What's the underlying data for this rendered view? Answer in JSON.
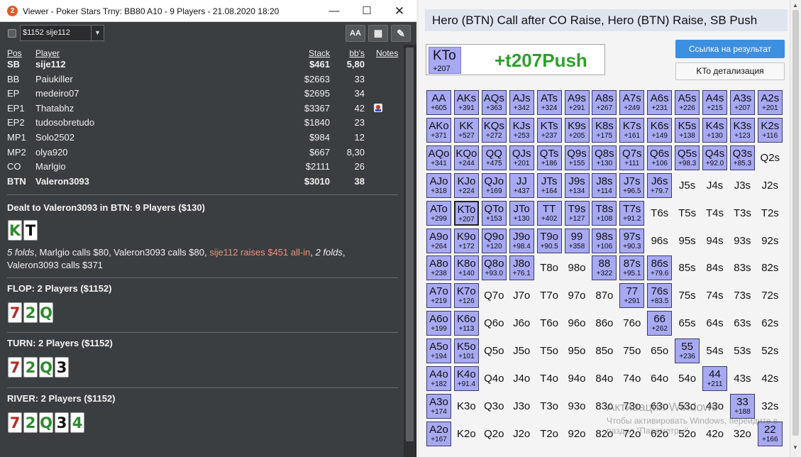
{
  "window": {
    "badge": "2",
    "title": "Viewer - Poker Stars Trny: BB80 A10 - 9 Players - 21.08.2020 18:20"
  },
  "toolbar": {
    "select_value": "$1152 sije112",
    "aa_label": "AA"
  },
  "players_table": {
    "headers": {
      "pos": "Pos",
      "player": "Player",
      "stack": "Stack",
      "bbs": "bb's",
      "notes": "Notes"
    },
    "rows": [
      {
        "pos": "SB",
        "name": "sije112",
        "stack": "$461",
        "bb": "5,80",
        "bold": true
      },
      {
        "pos": "BB",
        "name": "Paiukiller",
        "stack": "$2663",
        "bb": "33",
        "bold": false
      },
      {
        "pos": "EP",
        "name": "medeiro07",
        "stack": "$2695",
        "bb": "34",
        "bold": false
      },
      {
        "pos": "EP1",
        "name": "Thatabhz",
        "stack": "$3367",
        "bb": "42",
        "bold": false,
        "note": true
      },
      {
        "pos": "EP2",
        "name": "tudosobretudo",
        "stack": "$1840",
        "bb": "23",
        "bold": false
      },
      {
        "pos": "MP1",
        "name": "Solo2502",
        "stack": "$984",
        "bb": "12",
        "bold": false
      },
      {
        "pos": "MP2",
        "name": "olya920",
        "stack": "$667",
        "bb": "8,30",
        "bold": false
      },
      {
        "pos": "CO",
        "name": "Marlgio",
        "stack": "$2111",
        "bb": "26",
        "bold": false
      },
      {
        "pos": "BTN",
        "name": "Valeron3093",
        "stack": "$3010",
        "bb": "38",
        "bold": true
      }
    ]
  },
  "dealt": {
    "title": "Dealt to Valeron3093 in BTN: 9 Players ($130)",
    "cards": [
      {
        "rank": "K",
        "suit": "c"
      },
      {
        "rank": "T",
        "suit": "s"
      }
    ],
    "action_segments": [
      {
        "text": "5 folds",
        "style": "it"
      },
      {
        "text": ", Marlgio calls $80, Valeron3093 calls $80, ",
        "style": ""
      },
      {
        "text": "sije112 raises $451 all-in",
        "style": "raise"
      },
      {
        "text": ", ",
        "style": ""
      },
      {
        "text": "2 folds",
        "style": "it"
      },
      {
        "text": ",",
        "style": ""
      },
      {
        "text": " Valeron3093 calls $371",
        "style": ""
      }
    ]
  },
  "streets": [
    {
      "title": "FLOP: 2 Players ($1152)",
      "cards": [
        {
          "rank": "7",
          "suit": "h"
        },
        {
          "rank": "2",
          "suit": "c"
        },
        {
          "rank": "Q",
          "suit": "c"
        }
      ]
    },
    {
      "title": "TURN: 2 Players ($1152)",
      "cards": [
        {
          "rank": "7",
          "suit": "h"
        },
        {
          "rank": "2",
          "suit": "c"
        },
        {
          "rank": "Q",
          "suit": "c"
        },
        {
          "rank": "3",
          "suit": "s"
        }
      ]
    },
    {
      "title": "RIVER: 2 Players ($1152)",
      "cards": [
        {
          "rank": "7",
          "suit": "h"
        },
        {
          "rank": "2",
          "suit": "c"
        },
        {
          "rank": "Q",
          "suit": "c"
        },
        {
          "rank": "3",
          "suit": "s"
        },
        {
          "rank": "4",
          "suit": "c"
        }
      ]
    }
  ],
  "right_panel": {
    "header": "Hero (BTN) Call after CO Raise, Hero (BTN) Raise, SB Push",
    "hand": "KTo",
    "hand_ev": "+207",
    "result": "+t207Push",
    "link_button": "Ссылка на результат",
    "detail_button": "KTo детализация"
  },
  "range_grid": [
    [
      [
        "AA",
        "+605"
      ],
      [
        "AKs",
        "+391"
      ],
      [
        "AQs",
        "+363"
      ],
      [
        "AJs",
        "+342"
      ],
      [
        "ATs",
        "+324"
      ],
      [
        "A9s",
        "+291"
      ],
      [
        "A8s",
        "+267"
      ],
      [
        "A7s",
        "+249"
      ],
      [
        "A6s",
        "+231"
      ],
      [
        "A5s",
        "+226"
      ],
      [
        "A4s",
        "+215"
      ],
      [
        "A3s",
        "+207"
      ],
      [
        "A2s",
        "+201"
      ]
    ],
    [
      [
        "AKo",
        "+371"
      ],
      [
        "KK",
        "+527"
      ],
      [
        "KQs",
        "+272"
      ],
      [
        "KJs",
        "+253"
      ],
      [
        "KTs",
        "+237"
      ],
      [
        "K9s",
        "+205"
      ],
      [
        "K8s",
        "+175"
      ],
      [
        "K7s",
        "+161"
      ],
      [
        "K6s",
        "+149"
      ],
      [
        "K5s",
        "+138"
      ],
      [
        "K4s",
        "+130"
      ],
      [
        "K3s",
        "+123"
      ],
      [
        "K2s",
        "+116"
      ]
    ],
    [
      [
        "AQo",
        "+341"
      ],
      [
        "KQo",
        "+244"
      ],
      [
        "QQ",
        "+475"
      ],
      [
        "QJs",
        "+201"
      ],
      [
        "QTs",
        "+186"
      ],
      [
        "Q9s",
        "+155"
      ],
      [
        "Q8s",
        "+130"
      ],
      [
        "Q7s",
        "+111"
      ],
      [
        "Q6s",
        "+106"
      ],
      [
        "Q5s",
        "+98.3"
      ],
      [
        "Q4s",
        "+92.0"
      ],
      [
        "Q3s",
        "+85.3"
      ],
      [
        "Q2s",
        ""
      ]
    ],
    [
      [
        "AJo",
        "+318"
      ],
      [
        "KJo",
        "+224"
      ],
      [
        "QJo",
        "+169"
      ],
      [
        "JJ",
        "+437"
      ],
      [
        "JTs",
        "+164"
      ],
      [
        "J9s",
        "+134"
      ],
      [
        "J8s",
        "+114"
      ],
      [
        "J7s",
        "+96.5"
      ],
      [
        "J6s",
        "+79.7"
      ],
      [
        "J5s",
        ""
      ],
      [
        "J4s",
        ""
      ],
      [
        "J3s",
        ""
      ],
      [
        "J2s",
        ""
      ]
    ],
    [
      [
        "ATo",
        "+299"
      ],
      [
        "KTo",
        "+207"
      ],
      [
        "QTo",
        "+153"
      ],
      [
        "JTo",
        "+130"
      ],
      [
        "TT",
        "+402"
      ],
      [
        "T9s",
        "+127"
      ],
      [
        "T8s",
        "+108"
      ],
      [
        "T7s",
        "+91.2"
      ],
      [
        "T6s",
        ""
      ],
      [
        "T5s",
        ""
      ],
      [
        "T4s",
        ""
      ],
      [
        "T3s",
        ""
      ],
      [
        "T2s",
        ""
      ]
    ],
    [
      [
        "A9o",
        "+264"
      ],
      [
        "K9o",
        "+172"
      ],
      [
        "Q9o",
        "+120"
      ],
      [
        "J9o",
        "+98.4"
      ],
      [
        "T9o",
        "+90.5"
      ],
      [
        "99",
        "+358"
      ],
      [
        "98s",
        "+106"
      ],
      [
        "97s",
        "+90.3"
      ],
      [
        "96s",
        ""
      ],
      [
        "95s",
        ""
      ],
      [
        "94s",
        ""
      ],
      [
        "93s",
        ""
      ],
      [
        "92s",
        ""
      ]
    ],
    [
      [
        "A8o",
        "+238"
      ],
      [
        "K8o",
        "+140"
      ],
      [
        "Q8o",
        "+93.0"
      ],
      [
        "J8o",
        "+76.1"
      ],
      [
        "T8o",
        ""
      ],
      [
        "98o",
        ""
      ],
      [
        "88",
        "+322"
      ],
      [
        "87s",
        "+95.1"
      ],
      [
        "86s",
        "+79.6"
      ],
      [
        "85s",
        ""
      ],
      [
        "84s",
        ""
      ],
      [
        "83s",
        ""
      ],
      [
        "82s",
        ""
      ]
    ],
    [
      [
        "A7o",
        "+219"
      ],
      [
        "K7o",
        "+126"
      ],
      [
        "Q7o",
        ""
      ],
      [
        "J7o",
        ""
      ],
      [
        "T7o",
        ""
      ],
      [
        "97o",
        ""
      ],
      [
        "87o",
        ""
      ],
      [
        "77",
        "+291"
      ],
      [
        "76s",
        "+83.5"
      ],
      [
        "75s",
        ""
      ],
      [
        "74s",
        ""
      ],
      [
        "73s",
        ""
      ],
      [
        "72s",
        ""
      ]
    ],
    [
      [
        "A6o",
        "+199"
      ],
      [
        "K6o",
        "+113"
      ],
      [
        "Q6o",
        ""
      ],
      [
        "J6o",
        ""
      ],
      [
        "T6o",
        ""
      ],
      [
        "96o",
        ""
      ],
      [
        "86o",
        ""
      ],
      [
        "76o",
        ""
      ],
      [
        "66",
        "+262"
      ],
      [
        "65s",
        ""
      ],
      [
        "64s",
        ""
      ],
      [
        "63s",
        ""
      ],
      [
        "62s",
        ""
      ]
    ],
    [
      [
        "A5o",
        "+194"
      ],
      [
        "K5o",
        "+101"
      ],
      [
        "Q5o",
        ""
      ],
      [
        "J5o",
        ""
      ],
      [
        "T5o",
        ""
      ],
      [
        "95o",
        ""
      ],
      [
        "85o",
        ""
      ],
      [
        "75o",
        ""
      ],
      [
        "65o",
        ""
      ],
      [
        "55",
        "+236"
      ],
      [
        "54s",
        ""
      ],
      [
        "53s",
        ""
      ],
      [
        "52s",
        ""
      ]
    ],
    [
      [
        "A4o",
        "+182"
      ],
      [
        "K4o",
        "+91.4"
      ],
      [
        "Q4o",
        ""
      ],
      [
        "J4o",
        ""
      ],
      [
        "T4o",
        ""
      ],
      [
        "94o",
        ""
      ],
      [
        "84o",
        ""
      ],
      [
        "74o",
        ""
      ],
      [
        "64o",
        ""
      ],
      [
        "54o",
        ""
      ],
      [
        "44",
        "+211"
      ],
      [
        "43s",
        ""
      ],
      [
        "42s",
        ""
      ]
    ],
    [
      [
        "A3o",
        "+174"
      ],
      [
        "K3o",
        ""
      ],
      [
        "Q3o",
        ""
      ],
      [
        "J3o",
        ""
      ],
      [
        "T3o",
        ""
      ],
      [
        "93o",
        ""
      ],
      [
        "83o",
        ""
      ],
      [
        "73o",
        ""
      ],
      [
        "63o",
        ""
      ],
      [
        "53o",
        ""
      ],
      [
        "43o",
        ""
      ],
      [
        "33",
        "+188"
      ],
      [
        "32s",
        ""
      ]
    ],
    [
      [
        "A2o",
        "+167"
      ],
      [
        "K2o",
        ""
      ],
      [
        "Q2o",
        ""
      ],
      [
        "J2o",
        ""
      ],
      [
        "T2o",
        ""
      ],
      [
        "92o",
        ""
      ],
      [
        "82o",
        ""
      ],
      [
        "72o",
        ""
      ],
      [
        "62o",
        ""
      ],
      [
        "52o",
        ""
      ],
      [
        "42o",
        ""
      ],
      [
        "32o",
        ""
      ],
      [
        "22",
        "+166"
      ]
    ]
  ],
  "hero_hand": "KTo",
  "watermark": {
    "line1": "Активация Windows",
    "line2": "Чтобы активировать Windows, перейдите в",
    "line3": "раздел \"Параметры\"."
  },
  "colors": {
    "range_fill": "#a7a9f2",
    "result_green": "#2ea02e",
    "link_blue": "#3d8fe0",
    "viewer_bg": "#3b3e40"
  }
}
